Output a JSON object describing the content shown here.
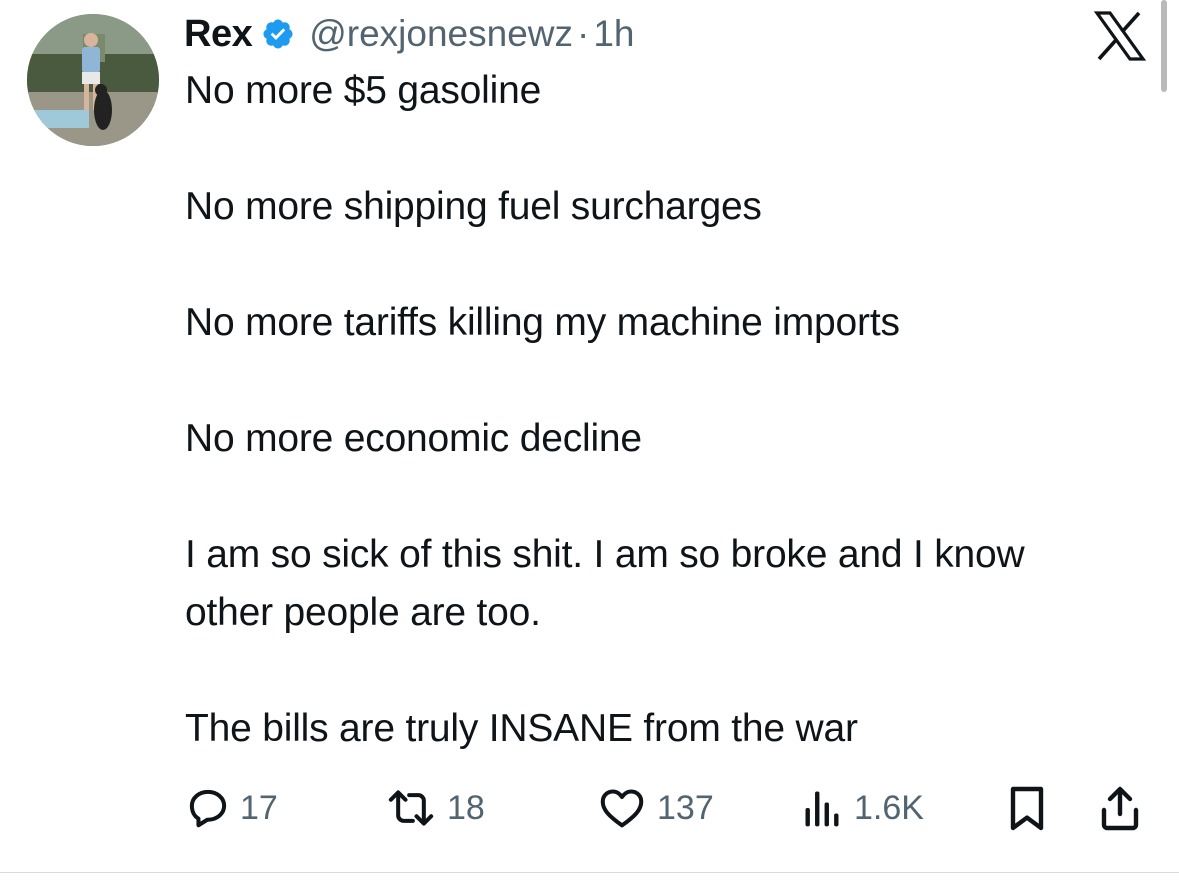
{
  "tweet": {
    "author_name": "Rex",
    "handle": "@rexjonesnewz",
    "separator": "·",
    "time": "1h",
    "verified": true,
    "text": {
      "line1": "No more $5 gasoline",
      "line2": "No more shipping fuel surcharges",
      "line3": "No more tariffs killing my machine imports",
      "line4": "No more economic decline",
      "line5": "I am so sick of this shit. I am so broke and I know other people are too.",
      "line6": "The bills are truly INSANE from the war"
    }
  },
  "actions": {
    "replies": "17",
    "reposts": "18",
    "likes": "137",
    "views": "1.6K"
  },
  "icons": {
    "reply": "speech-bubble-icon",
    "repost": "repost-arrows-icon",
    "like": "heart-icon",
    "views": "bar-chart-icon",
    "bookmark": "bookmark-icon",
    "share": "share-upload-icon",
    "close": "x-logo-icon"
  },
  "colors": {
    "text": "#0f1419",
    "secondary": "#536471",
    "verified": "#1d9bf0"
  }
}
